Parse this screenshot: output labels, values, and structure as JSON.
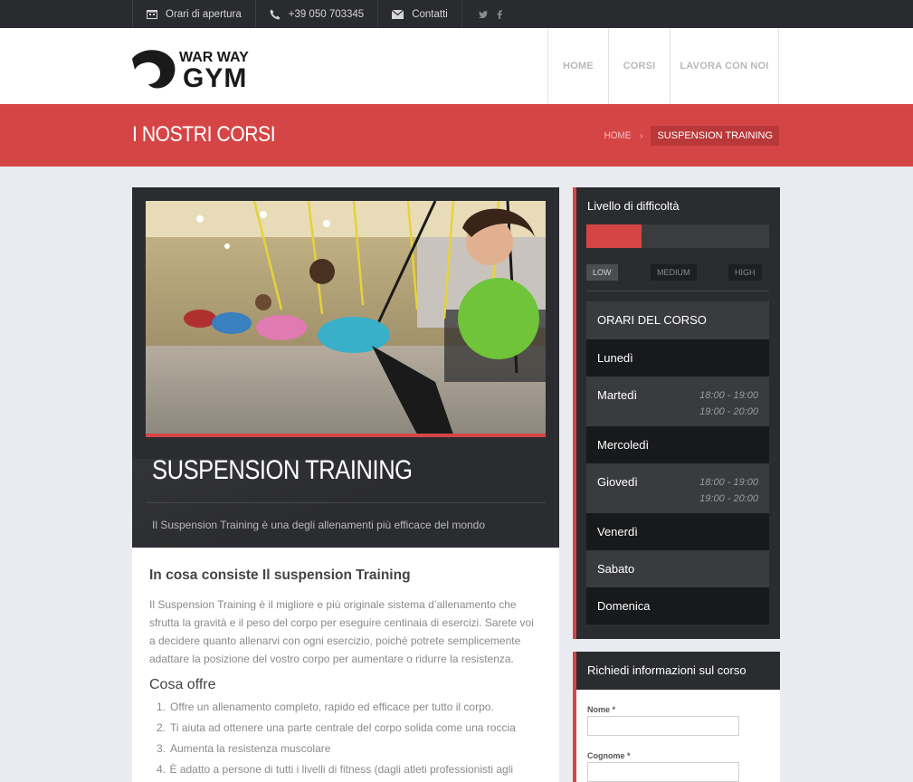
{
  "topbar": {
    "items": [
      {
        "icon": "calendar-icon",
        "label": "Orari di apertura"
      },
      {
        "icon": "phone-icon",
        "label": "+39 050 703345"
      },
      {
        "icon": "envelope-icon",
        "label": "Contatti"
      }
    ],
    "social": [
      "twitter-icon",
      "facebook-icon"
    ]
  },
  "header": {
    "logo_top": "WAR WAY",
    "logo_bottom": "GYM",
    "nav": [
      "HOME",
      "CORSI",
      "LAVORA CON NOI"
    ]
  },
  "banner": {
    "title": "I NOSTRI CORSI",
    "breadcrumb_home": "HOME",
    "breadcrumb_current": "SUSPENSION TRAINING"
  },
  "course": {
    "title": "SUSPENSION TRAINING",
    "subtitle": "Il Suspension Training è una degli allenamenti più efficace del mondo",
    "section1_title": "In cosa consiste Il suspension Training",
    "section1_text": "Il Suspension Training è il migliore e più originale sistema d’allenamento che sfrutta la gravità e il peso del corpo per eseguire centinaia di esercizi. Sarete voi a decidere quanto allenarvi con ogni esercizio, poiché potrete semplicemente adattare la posizione del vostro corpo per aumentare o ridurre la resistenza.",
    "section2_title": "Cosa offre",
    "list": [
      "Offre un allenamento completo, rapido ed efficace per tutto il corpo.",
      "Ti aiuta ad ottenere una parte centrale del corpo solida come una roccia",
      "Aumenta la resistenza muscolare",
      "È adatto a persone di tutti i livelli di fitness (dagli atleti professionisti agli anziani)"
    ]
  },
  "difficulty": {
    "title": "Livello di difficoltà",
    "level_fraction": 0.3,
    "levels": [
      "LOW",
      "MEDIUM",
      "HIGH"
    ],
    "active": "LOW"
  },
  "schedule": {
    "title": "ORARI DEL CORSO",
    "days": [
      {
        "name": "Lunedì",
        "times": []
      },
      {
        "name": "Martedì",
        "times": [
          "18:00 - 19:00",
          "19:00 - 20:00"
        ]
      },
      {
        "name": "Mercoledì",
        "times": []
      },
      {
        "name": "Giovedì",
        "times": [
          "18:00 - 19:00",
          "19:00 - 20:00"
        ]
      },
      {
        "name": "Venerdì",
        "times": []
      },
      {
        "name": "Sabato",
        "times": []
      },
      {
        "name": "Domenica",
        "times": []
      }
    ]
  },
  "info_form": {
    "title": "Richiedi informazioni sul corso",
    "name_label": "Nome *",
    "surname_label": "Cognome *"
  },
  "colors": {
    "accent": "#d64546",
    "dark": "#2b2c2f"
  }
}
